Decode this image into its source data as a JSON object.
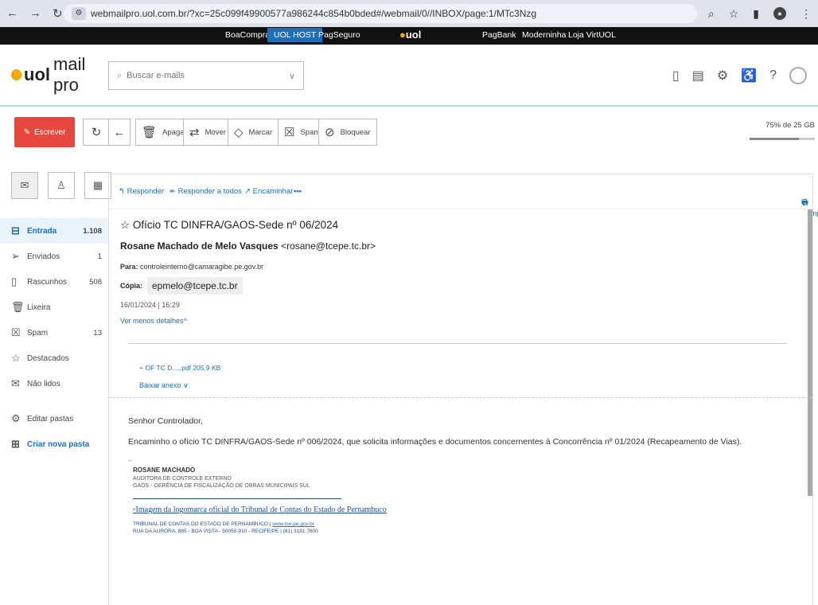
{
  "browser": {
    "url": "webmailpro.uol.com.br/?xc=25c099f49900577a986244c854b0bded#/webmail/0//INBOX/page:1/MTc3Nzg"
  },
  "topbar": {
    "links": [
      "BoaCompra",
      "UOL HOST",
      "PagSeguro",
      "PagBank",
      "Moderninha",
      "Loja VirtUOL"
    ],
    "logo": "uol"
  },
  "app": {
    "brand_uol": "uol",
    "brand_name": "mail pro",
    "search_placeholder": "Buscar e-mails"
  },
  "toolbar": {
    "compose": "Escrever",
    "delete": "Apagar",
    "move": "Mover",
    "mark": "Marcar",
    "spam": "Spam",
    "block": "Bloquear",
    "quota": "75% de 25 GB",
    "quota_fraction": 0.75
  },
  "sidebar": {
    "folders": [
      {
        "label": "Entrada",
        "count": "1.108"
      },
      {
        "label": "Enviados",
        "count": "1"
      },
      {
        "label": "Rascunhos",
        "count": "508"
      },
      {
        "label": "Lixeira",
        "count": ""
      },
      {
        "label": "Spam",
        "count": "13"
      },
      {
        "label": "Destacados",
        "count": ""
      },
      {
        "label": "Não lidos",
        "count": ""
      },
      {
        "label": "Editar pastas",
        "count": ""
      },
      {
        "label": "Criar nova pasta",
        "count": ""
      }
    ]
  },
  "actions": {
    "reply": "Responder",
    "reply_all": "Responder a todos",
    "forward": "Encaminhar",
    "more": "•••",
    "print": "Imprimir"
  },
  "message": {
    "subject": "Ofício TC DINFRA/GAOS-Sede nº 06/2024",
    "sender_name": "Rosane Machado de Melo Vasques",
    "sender_email": "<rosane@tcepe.tc.br>",
    "to_label": "Para:",
    "to": "controleinterno@camaragibe.pe.gov.br",
    "cc_label": "Cópia:",
    "cc": "epmelo@tcepe.tc.br",
    "date": "16/01/2024 | 16:29",
    "details_toggle": "Ver menos detalhes",
    "attachment": "OF TC D.....pdf  205.9 KB",
    "download": "Baixar anexo",
    "greeting": "Senhor Controlador,",
    "body": "Encaminho o ofício TC DINFRA/GAOS-Sede nº 006/2024, que solicita informações e documentos concernentes à Concorrência nº 01/2024 (Recapeamento de Vias).",
    "sig_dash": "--",
    "sig_name": "ROSANE MACHADO",
    "sig_role": "AUDITORA DE CONTROLE EXTERNO",
    "sig_dept": "GAOS - GERÊNCIA DE FISCALIZAÇÃO DE OBRAS MUNICIPAIS SUL",
    "sig_image_alt": "Imagem da logomarca oficial do Tribunal de Contas do Estado de Pernambuco",
    "sig_org": "TRIBUNAL DE CONTAS DO ESTADO DE PERNAMBUCO |",
    "sig_site": "www.tce.pe.gov.br",
    "sig_address": "RUA DA AURORA, 885 - BOA VISTA - 50050-910 - RECIFE/PE | (81) 3181 7600"
  }
}
